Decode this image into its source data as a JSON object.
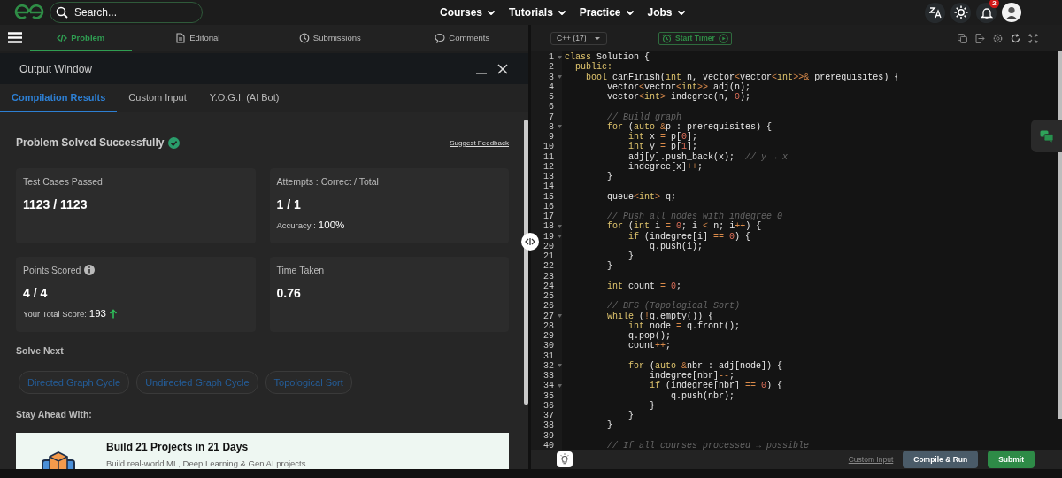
{
  "nav": {
    "search": {
      "placeholder": "Search..."
    },
    "menus": [
      {
        "label": "Courses"
      },
      {
        "label": "Tutorials"
      },
      {
        "label": "Practice"
      },
      {
        "label": "Jobs"
      }
    ],
    "notifications": {
      "count": "2"
    }
  },
  "problem_tabs": [
    {
      "label": "Problem",
      "selected": true
    },
    {
      "label": "Editorial",
      "selected": false
    },
    {
      "label": "Submissions",
      "selected": false
    },
    {
      "label": "Comments",
      "selected": false
    }
  ],
  "output_window": {
    "title": "Output Window",
    "tabs": [
      {
        "label": "Compilation Results",
        "selected": true
      },
      {
        "label": "Custom Input",
        "selected": false
      },
      {
        "label": "Y.O.G.I. (AI Bot)",
        "selected": false
      }
    ],
    "heading": "Problem Solved Successfully",
    "solved": true,
    "feedback_link": "Suggest Feedback",
    "stats": [
      {
        "label": "Test Cases Passed",
        "value": "1123 / 1123"
      },
      {
        "label": "Attempts : Correct / Total",
        "value": "1 / 1",
        "note_label": "Accuracy :",
        "note_value": "100%"
      },
      {
        "label": "Points Scored",
        "info": true,
        "value": "4 / 4",
        "note_label": "Your Total Score:",
        "note_value": "193",
        "rising": true
      },
      {
        "label": "Time Taken",
        "value": "0.76"
      }
    ],
    "solve_next": {
      "title": "Solve Next",
      "items": [
        "Directed Graph Cycle",
        "Undirected Graph Cycle",
        "Topological Sort"
      ]
    },
    "promo": {
      "title": "Stay Ahead With:",
      "card_title": "Build 21 Projects in 21 Days",
      "card_text": "Build real-world ML, Deep Learning & Gen AI projects"
    }
  },
  "editor": {
    "language": "C++ (17)",
    "timer": "Start Timer",
    "lines": [
      {
        "number": "1",
        "foldable": true,
        "tokens": [
          {
            "kind": "kw",
            "text": "class"
          },
          {
            "kind": "p",
            "text": " Solution {"
          }
        ]
      },
      {
        "number": "2",
        "foldable": false,
        "tokens": [
          {
            "kind": "kw",
            "text": "  public:"
          }
        ]
      },
      {
        "number": "3",
        "foldable": true,
        "tokens": [
          {
            "kind": "kw",
            "text": "    bool"
          },
          {
            "kind": "p",
            "text": " canFinish("
          },
          {
            "kind": "kw",
            "text": "int"
          },
          {
            "kind": "p",
            "text": " n, vector"
          },
          {
            "kind": "op",
            "text": "<"
          },
          {
            "kind": "p",
            "text": "vector"
          },
          {
            "kind": "op",
            "text": "<"
          },
          {
            "kind": "kw",
            "text": "int"
          },
          {
            "kind": "op",
            "text": ">>&"
          },
          {
            "kind": "p",
            "text": " prerequisites) {"
          }
        ]
      },
      {
        "number": "4",
        "foldable": false,
        "tokens": [
          {
            "kind": "p",
            "text": "        vector"
          },
          {
            "kind": "op",
            "text": "<"
          },
          {
            "kind": "p",
            "text": "vector"
          },
          {
            "kind": "op",
            "text": "<"
          },
          {
            "kind": "kw",
            "text": "int"
          },
          {
            "kind": "op",
            "text": ">>"
          },
          {
            "kind": "p",
            "text": " adj(n);"
          }
        ]
      },
      {
        "number": "5",
        "foldable": false,
        "tokens": [
          {
            "kind": "p",
            "text": "        vector"
          },
          {
            "kind": "op",
            "text": "<"
          },
          {
            "kind": "kw",
            "text": "int"
          },
          {
            "kind": "op",
            "text": ">"
          },
          {
            "kind": "p",
            "text": " indegree(n, "
          },
          {
            "kind": "num",
            "text": "0"
          },
          {
            "kind": "p",
            "text": ");"
          }
        ]
      },
      {
        "number": "6",
        "foldable": false
      },
      {
        "number": "7",
        "foldable": false,
        "tokens": [
          {
            "kind": "cmt",
            "text": "        // Build graph"
          }
        ]
      },
      {
        "number": "8",
        "foldable": true,
        "tokens": [
          {
            "kind": "kw",
            "text": "        for"
          },
          {
            "kind": "p",
            "text": " ("
          },
          {
            "kind": "kw",
            "text": "auto"
          },
          {
            "kind": "op",
            "text": " &"
          },
          {
            "kind": "p",
            "text": "p : prerequisites) {"
          }
        ]
      },
      {
        "number": "9",
        "foldable": false,
        "tokens": [
          {
            "kind": "kw",
            "text": "            int"
          },
          {
            "kind": "p",
            "text": " x "
          },
          {
            "kind": "op",
            "text": "="
          },
          {
            "kind": "p",
            "text": " p["
          },
          {
            "kind": "num",
            "text": "0"
          },
          {
            "kind": "p",
            "text": "];"
          }
        ]
      },
      {
        "number": "10",
        "foldable": false,
        "tokens": [
          {
            "kind": "kw",
            "text": "            int"
          },
          {
            "kind": "p",
            "text": " y "
          },
          {
            "kind": "op",
            "text": "="
          },
          {
            "kind": "p",
            "text": " p["
          },
          {
            "kind": "num",
            "text": "1"
          },
          {
            "kind": "p",
            "text": "];"
          }
        ]
      },
      {
        "number": "11",
        "foldable": false,
        "tokens": [
          {
            "kind": "p",
            "text": "            adj[y].push_back(x);  "
          },
          {
            "kind": "cmt",
            "text": "// y → x"
          }
        ]
      },
      {
        "number": "12",
        "foldable": false,
        "tokens": [
          {
            "kind": "p",
            "text": "            indegree[x]"
          },
          {
            "kind": "op",
            "text": "++"
          },
          {
            "kind": "p",
            "text": ";"
          }
        ]
      },
      {
        "number": "13",
        "foldable": false,
        "tokens": [
          {
            "kind": "p",
            "text": "        }"
          }
        ]
      },
      {
        "number": "14",
        "foldable": false
      },
      {
        "number": "15",
        "foldable": false,
        "tokens": [
          {
            "kind": "p",
            "text": "        queue"
          },
          {
            "kind": "op",
            "text": "<"
          },
          {
            "kind": "kw",
            "text": "int"
          },
          {
            "kind": "op",
            "text": ">"
          },
          {
            "kind": "p",
            "text": " q;"
          }
        ]
      },
      {
        "number": "16",
        "foldable": false
      },
      {
        "number": "17",
        "foldable": false,
        "tokens": [
          {
            "kind": "cmt",
            "text": "        // Push all nodes with indegree 0"
          }
        ]
      },
      {
        "number": "18",
        "foldable": true,
        "tokens": [
          {
            "kind": "kw",
            "text": "        for"
          },
          {
            "kind": "p",
            "text": " ("
          },
          {
            "kind": "kw",
            "text": "int"
          },
          {
            "kind": "p",
            "text": " i "
          },
          {
            "kind": "op",
            "text": "= "
          },
          {
            "kind": "num",
            "text": "0"
          },
          {
            "kind": "p",
            "text": "; i "
          },
          {
            "kind": "op",
            "text": "<"
          },
          {
            "kind": "p",
            "text": " n; i"
          },
          {
            "kind": "op",
            "text": "++"
          },
          {
            "kind": "p",
            "text": ") {"
          }
        ]
      },
      {
        "number": "19",
        "foldable": true,
        "tokens": [
          {
            "kind": "kw",
            "text": "            if"
          },
          {
            "kind": "p",
            "text": " (indegree[i] "
          },
          {
            "kind": "op",
            "text": "== "
          },
          {
            "kind": "num",
            "text": "0"
          },
          {
            "kind": "p",
            "text": ") {"
          }
        ]
      },
      {
        "number": "20",
        "foldable": false,
        "tokens": [
          {
            "kind": "p",
            "text": "                q.push(i);"
          }
        ]
      },
      {
        "number": "21",
        "foldable": false,
        "tokens": [
          {
            "kind": "p",
            "text": "            }"
          }
        ]
      },
      {
        "number": "22",
        "foldable": false,
        "tokens": [
          {
            "kind": "p",
            "text": "        }"
          }
        ]
      },
      {
        "number": "23",
        "foldable": false
      },
      {
        "number": "24",
        "foldable": false,
        "tokens": [
          {
            "kind": "kw",
            "text": "        int"
          },
          {
            "kind": "p",
            "text": " count "
          },
          {
            "kind": "op",
            "text": "= "
          },
          {
            "kind": "num",
            "text": "0"
          },
          {
            "kind": "p",
            "text": ";"
          }
        ]
      },
      {
        "number": "25",
        "foldable": false
      },
      {
        "number": "26",
        "foldable": false,
        "tokens": [
          {
            "kind": "cmt",
            "text": "        // BFS (Topological Sort)"
          }
        ]
      },
      {
        "number": "27",
        "foldable": true,
        "tokens": [
          {
            "kind": "kw",
            "text": "        while"
          },
          {
            "kind": "p",
            "text": " ("
          },
          {
            "kind": "op",
            "text": "!"
          },
          {
            "kind": "p",
            "text": "q.empty()) {"
          }
        ]
      },
      {
        "number": "28",
        "foldable": false,
        "tokens": [
          {
            "kind": "kw",
            "text": "            int"
          },
          {
            "kind": "p",
            "text": " node "
          },
          {
            "kind": "op",
            "text": "="
          },
          {
            "kind": "p",
            "text": " q.front();"
          }
        ]
      },
      {
        "number": "29",
        "foldable": false,
        "tokens": [
          {
            "kind": "p",
            "text": "            q.pop();"
          }
        ]
      },
      {
        "number": "30",
        "foldable": false,
        "tokens": [
          {
            "kind": "p",
            "text": "            count"
          },
          {
            "kind": "op",
            "text": "++"
          },
          {
            "kind": "p",
            "text": ";"
          }
        ]
      },
      {
        "number": "31",
        "foldable": false
      },
      {
        "number": "32",
        "foldable": true,
        "tokens": [
          {
            "kind": "kw",
            "text": "            for"
          },
          {
            "kind": "p",
            "text": " ("
          },
          {
            "kind": "kw",
            "text": "auto"
          },
          {
            "kind": "op",
            "text": " &"
          },
          {
            "kind": "p",
            "text": "nbr : adj[node]) {"
          }
        ]
      },
      {
        "number": "33",
        "foldable": false,
        "tokens": [
          {
            "kind": "p",
            "text": "                indegree[nbr]"
          },
          {
            "kind": "op",
            "text": "--"
          },
          {
            "kind": "p",
            "text": ";"
          }
        ]
      },
      {
        "number": "34",
        "foldable": true,
        "tokens": [
          {
            "kind": "kw",
            "text": "                if"
          },
          {
            "kind": "p",
            "text": " (indegree[nbr] "
          },
          {
            "kind": "op",
            "text": "== "
          },
          {
            "kind": "num",
            "text": "0"
          },
          {
            "kind": "p",
            "text": ") {"
          }
        ]
      },
      {
        "number": "35",
        "foldable": false,
        "tokens": [
          {
            "kind": "p",
            "text": "                    q.push(nbr);"
          }
        ]
      },
      {
        "number": "36",
        "foldable": false,
        "tokens": [
          {
            "kind": "p",
            "text": "                }"
          }
        ]
      },
      {
        "number": "37",
        "foldable": false,
        "tokens": [
          {
            "kind": "p",
            "text": "            }"
          }
        ]
      },
      {
        "number": "38",
        "foldable": false,
        "tokens": [
          {
            "kind": "p",
            "text": "        }"
          }
        ]
      },
      {
        "number": "39",
        "foldable": false
      },
      {
        "number": "40",
        "foldable": false,
        "tokens": [
          {
            "kind": "cmt",
            "text": "        // If all courses processed → possible"
          }
        ]
      }
    ]
  },
  "footer": {
    "custom_input": "Custom Input",
    "buttons": [
      {
        "label": "Compile & Run",
        "kind": "secondary"
      },
      {
        "label": "Submit",
        "kind": "primary"
      }
    ]
  }
}
